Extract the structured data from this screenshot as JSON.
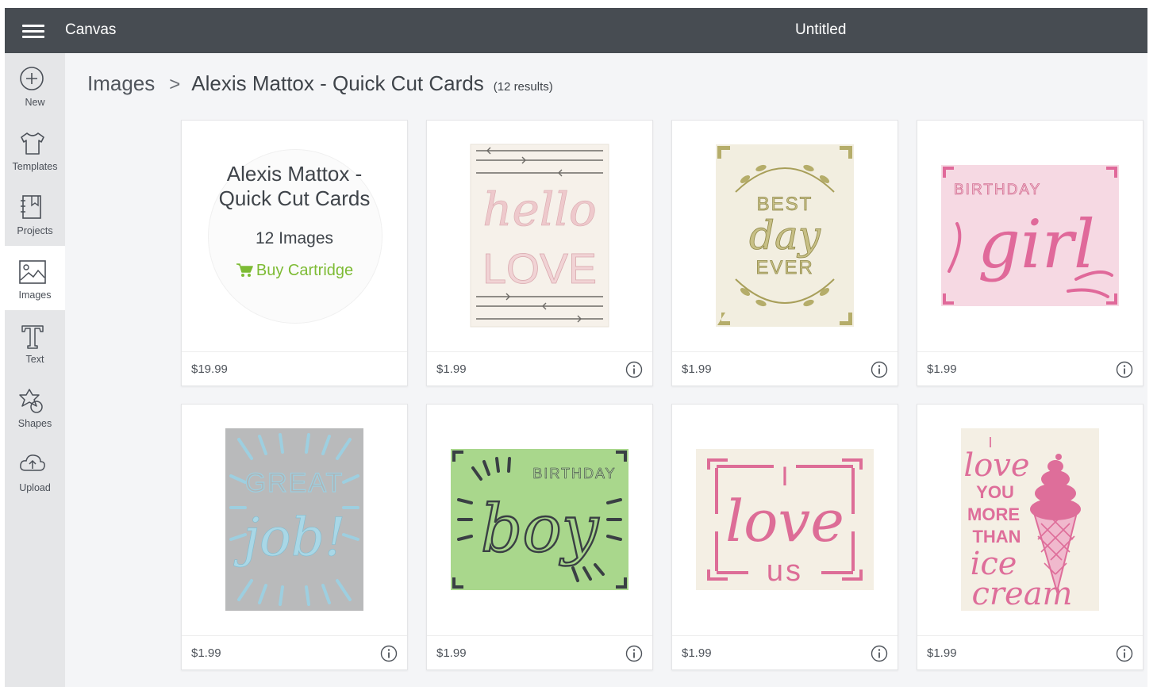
{
  "topbar": {
    "app_title": "Canvas",
    "document_title": "Untitled"
  },
  "sidebar": {
    "items": [
      {
        "label": "New",
        "icon": "plus-circle-icon"
      },
      {
        "label": "Templates",
        "icon": "shirt-icon"
      },
      {
        "label": "Projects",
        "icon": "projects-icon"
      },
      {
        "label": "Images",
        "icon": "image-icon",
        "active": true
      },
      {
        "label": "Text",
        "icon": "text-icon"
      },
      {
        "label": "Shapes",
        "icon": "shapes-icon"
      },
      {
        "label": "Upload",
        "icon": "upload-icon"
      }
    ]
  },
  "breadcrumb": {
    "root": "Images",
    "separator": ">",
    "current": "Alexis Mattox - Quick Cut Cards",
    "count": "(12 results)"
  },
  "cartridge": {
    "title": "Alexis Mattox - Quick Cut Cards",
    "image_count": "12 Images",
    "buy_label": "Buy Cartridge",
    "price": "$19.99"
  },
  "cards": [
    {
      "price": "$1.99",
      "art": [
        "hello",
        "LOVE"
      ],
      "art_color": "#eec9cc",
      "bg": "#f6f1ea"
    },
    {
      "price": "$1.99",
      "art": [
        "BEST",
        "day",
        "EVER"
      ],
      "art_color": "#b5ad6a",
      "bg": "#f2eee0"
    },
    {
      "price": "$1.99",
      "art": [
        "BIRTHDAY",
        "girl"
      ],
      "art_color": "#e0699a",
      "bg": "#f6d9e3"
    },
    {
      "price": "$1.99",
      "art": [
        "GREAT",
        "job!"
      ],
      "art_color": "#9dcfe0",
      "bg": "#b9babb"
    },
    {
      "price": "$1.99",
      "art": [
        "BIRTHDAY",
        "boy"
      ],
      "art_color": "#3a3f44",
      "bg": "#a9d78c"
    },
    {
      "price": "$1.99",
      "art": [
        "I",
        "love",
        "us"
      ],
      "art_color": "#dd6d97",
      "bg": "#f4efe4"
    },
    {
      "price": "$1.99",
      "art": [
        "I",
        "love",
        "YOU",
        "MORE",
        "THAN",
        "ice",
        "cream"
      ],
      "art_color": "#de6e9a",
      "bg": "#f4efe4"
    }
  ],
  "colors": {
    "topbar": "#474c52",
    "accent_green": "#7dbb34",
    "sidebar_bg": "#e5e6e8"
  }
}
